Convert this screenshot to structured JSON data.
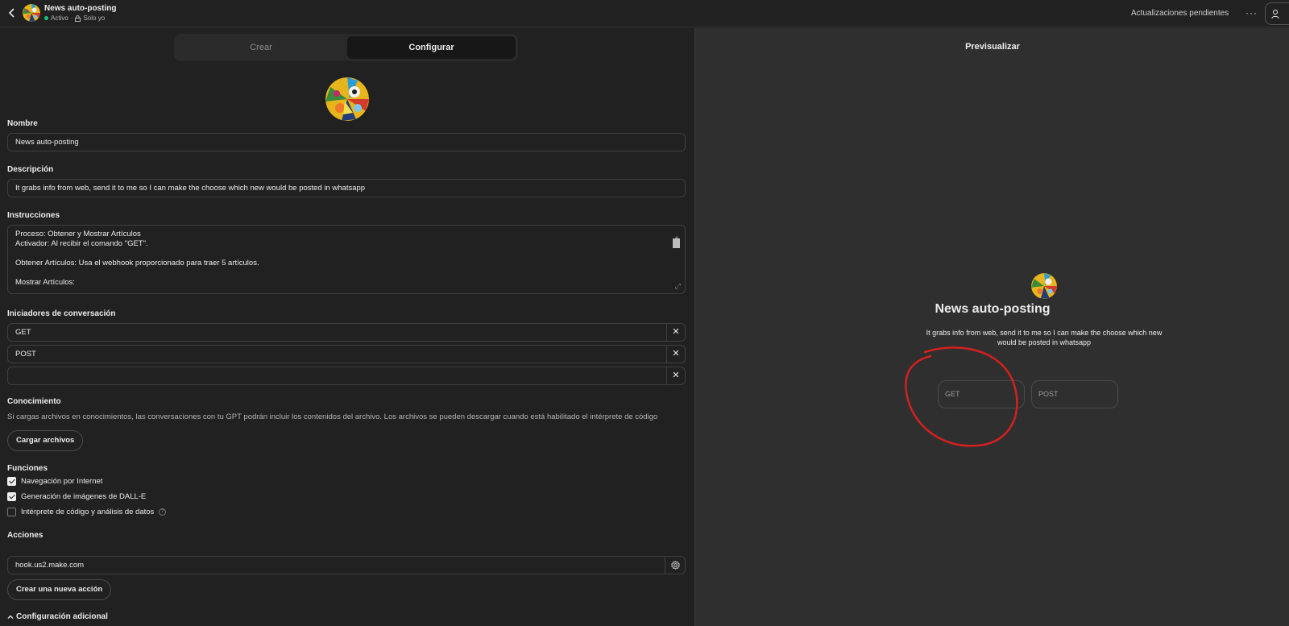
{
  "header": {
    "title": "News auto-posting",
    "status": "Activo",
    "visibility": "Solo yo",
    "pending": "Actualizaciones pendientes",
    "more": "···"
  },
  "tabs": [
    {
      "label": "Crear"
    },
    {
      "label": "Configurar"
    }
  ],
  "form": {
    "name_label": "Nombre",
    "name_value": "News auto-posting",
    "description_label": "Descripción",
    "description_value": "It grabs info from web, send it to me so I can make the choose which new would be posted in whatsapp",
    "instructions_label": "Instrucciones",
    "instructions_lines": [
      "Proceso: Obtener y Mostrar Artículos",
      "Activador: Al recibir el comando \"GET\".",
      "",
      "Obtener Artículos: Usa el webhook proporcionado para traer 5 artículos.",
      "",
      "Mostrar Artículos:"
    ],
    "starters_label": "Iniciadores de conversación",
    "starters": [
      "GET",
      "POST",
      ""
    ],
    "remove_glyph": "✕",
    "knowledge_label": "Conocimiento",
    "knowledge_desc": "Si cargas archivos en conocimientos, las conversaciones con tu GPT podrán incluir los contenidos del archivo. Los archivos se pueden descargar cuando está habilitado el intérprete de código",
    "upload_button": "Cargar archivos",
    "functions_label": "Funciones",
    "functions": [
      {
        "label": "Navegación por Internet",
        "checked": true
      },
      {
        "label": "Generación de imágenes de DALL-E",
        "checked": true
      },
      {
        "label": "Intérprete de código y análisis de datos",
        "checked": false
      }
    ],
    "info_glyph": "?",
    "actions_label": "Acciones",
    "action_value": "hook.us2.make.com",
    "new_action_button": "Crear una nueva acción",
    "additional_label": "Configuración adicional"
  },
  "preview": {
    "title": "Previsualizar",
    "gpt_name": "News auto-posting",
    "gpt_desc": "It grabs info from web, send it to me so I can make the choose which new would be posted in whatsapp",
    "starters": [
      "GET",
      "POST"
    ]
  },
  "colors": {
    "background": "#212121",
    "preview_background": "#2f2f2f",
    "status_green": "#19c37d",
    "annotation_red": "#d42020"
  }
}
